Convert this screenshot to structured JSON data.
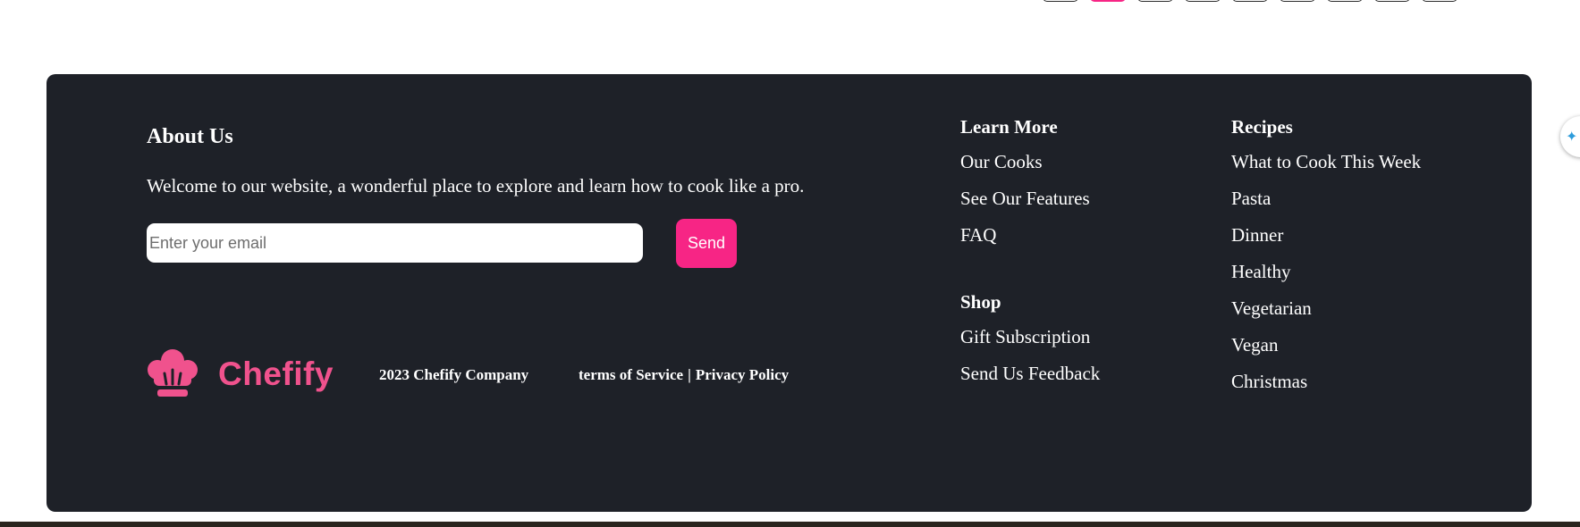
{
  "pagination": {
    "active_index": 1,
    "count": 9
  },
  "about": {
    "title": "About Us",
    "text": "Welcome to our website, a wonderful place to explore and learn how to cook like a pro.",
    "email_placeholder": "Enter your email",
    "send_label": "Send"
  },
  "brand": {
    "name": "Chefify",
    "logo_icon": "chef-hat-icon",
    "accent_color": "#f72585",
    "logo_color": "#f0528d"
  },
  "legal": {
    "copyright": "2023 Chefify Company",
    "terms": "terms of Service",
    "separator": "|",
    "privacy": "Privacy Policy"
  },
  "learn_more": {
    "title": "Learn More",
    "items": [
      "Our Cooks",
      "See Our Features",
      "FAQ"
    ]
  },
  "shop": {
    "title": "Shop",
    "items": [
      "Gift Subscription",
      "Send Us Feedback"
    ]
  },
  "recipes": {
    "title": "Recipes",
    "items": [
      "What to Cook This Week",
      "Pasta",
      "Dinner",
      "Healthy",
      "Vegetarian",
      "Vegan",
      "Christmas"
    ]
  },
  "colors": {
    "footer_bg": "#1e2128",
    "text": "#ffffff"
  },
  "widget": {
    "icon": "sparkle-icon"
  }
}
